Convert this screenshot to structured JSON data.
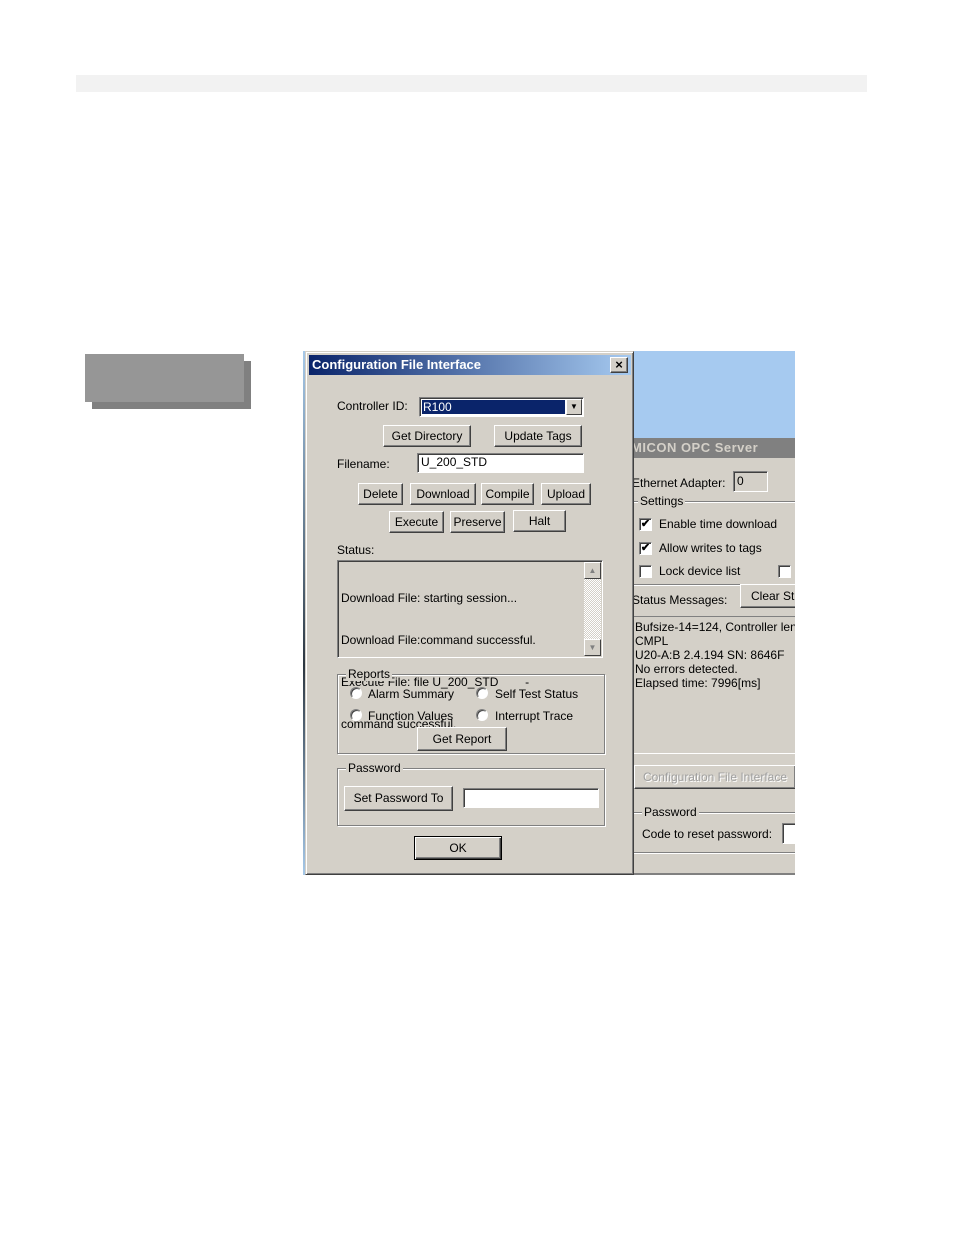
{
  "page": {
    "header_bar": "",
    "side_tab": ""
  },
  "dialog": {
    "title": "Configuration File Interface",
    "close_icon": "×",
    "controller_id_label": "Controller ID:",
    "controller_id_value": "R100",
    "dropdown_icon": "▼",
    "get_directory": "Get Directory",
    "update_tags": "Update Tags",
    "filename_label": "Filename:",
    "filename_value": "U_200_STD",
    "buttons_row1": [
      "Delete",
      "Download",
      "Compile",
      "Upload"
    ],
    "buttons_row2": [
      "Execute",
      "Preserve",
      "Halt"
    ],
    "status_label": "Status:",
    "status_lines": [
      "Download File: starting session...",
      "Download File:command successful.",
      "Execute File: file U_200_STD        -",
      "command successful."
    ],
    "scroll_up_icon": "▲",
    "scroll_down_icon": "▼",
    "reports": {
      "legend": "Reports",
      "options": [
        "Alarm Summary",
        "Self Test Status",
        "Function Values",
        "Interrupt Trace"
      ],
      "get_report": "Get Report"
    },
    "password": {
      "legend": "Password",
      "set_button": "Set Password To",
      "value": ""
    },
    "ok": "OK"
  },
  "opc_window": {
    "title": "MICON OPC Server",
    "ethernet_label": "Ethernet Adapter:",
    "ethernet_value": "0",
    "settings_legend": "Settings",
    "checkboxes": [
      {
        "label": "Enable time download",
        "checked": true
      },
      {
        "label": "Allow writes to tags",
        "checked": true
      },
      {
        "label": "Lock device list",
        "checked": false
      }
    ],
    "check_mark": "✔",
    "status_messages_label": "Status Messages:",
    "clear_button": "Clear St",
    "log_lines": [
      "Bufsize-14=124, Controller len",
      "CMPL",
      "U20-A:B  2.4.194  SN: 8646F",
      "No errors detected.",
      "Elapsed time: 7996[ms]"
    ],
    "config_file_button": "Configuration File Interface",
    "password_legend": "Password",
    "reset_label": "Code to reset password:"
  }
}
